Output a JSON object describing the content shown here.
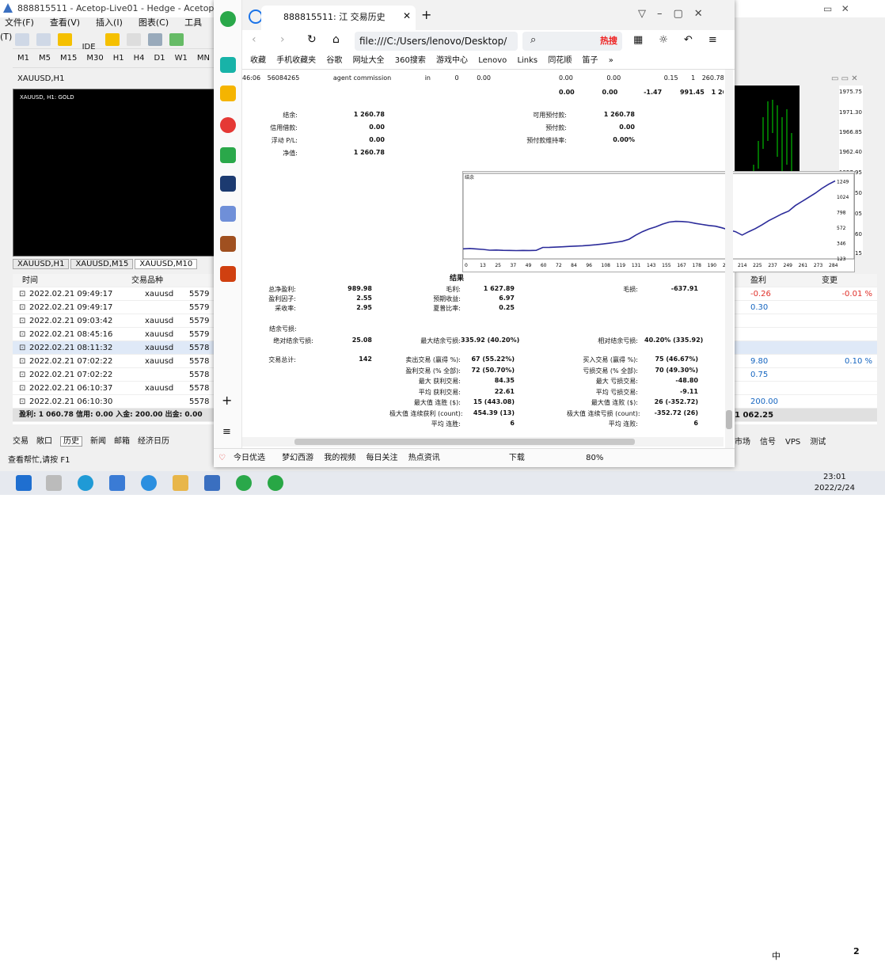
{
  "mt4": {
    "title": "888815511 - Acetop-Live01 - Hedge - Acetop Global",
    "menu": [
      "文件(F)",
      "查看(V)",
      "插入(I)",
      "图表(C)",
      "工具(T)"
    ],
    "toolbar_ide": "IDE",
    "timeframes": [
      "M1",
      "M5",
      "M15",
      "M30",
      "H1",
      "H4",
      "D1",
      "W1",
      "MN"
    ],
    "chart_window_title": "XAUUSD,H1",
    "chart_label": "XAUUSD, H1: GOLD",
    "chart_tabs": [
      "XAUUSD,H1",
      "XAUUSD,M15",
      "XAUUSD,M10"
    ],
    "axis_right": [
      "1975.75",
      "1971.30",
      "1966.85",
      "1962.40",
      "1957.95",
      "1953.50",
      "1949.05",
      "1944.60",
      "1940.15"
    ],
    "table_headers": {
      "time": "时间",
      "symbol": "交易品种",
      "profit": "盈利",
      "change": "变更"
    },
    "trades": [
      {
        "time": "2022.02.21 09:49:17",
        "symbol": "xauusd",
        "id": "5579"
      },
      {
        "time": "2022.02.21 09:49:17",
        "symbol": "",
        "id": "5579"
      },
      {
        "time": "2022.02.21 09:03:42",
        "symbol": "xauusd",
        "id": "5579"
      },
      {
        "time": "2022.02.21 08:45:16",
        "symbol": "xauusd",
        "id": "5579"
      },
      {
        "time": "2022.02.21 08:11:32",
        "symbol": "xauusd",
        "id": "5578"
      },
      {
        "time": "2022.02.21 07:02:22",
        "symbol": "xauusd",
        "id": "5578"
      },
      {
        "time": "2022.02.21 07:02:22",
        "symbol": "",
        "id": "5578"
      },
      {
        "time": "2022.02.21 06:10:37",
        "symbol": "xauusd",
        "id": "5578"
      },
      {
        "time": "2022.02.21 06:10:30",
        "symbol": "",
        "id": "5578"
      }
    ],
    "right_values": [
      {
        "profit": "-0.26",
        "change": "-0.01 %"
      },
      {
        "profit": "0.30",
        "change": ""
      },
      {
        "profit": "",
        "change": ""
      },
      {
        "profit": "",
        "change": ""
      },
      {
        "profit": "",
        "change": ""
      },
      {
        "profit": "9.80",
        "change": "0.10 %"
      },
      {
        "profit": "0.75",
        "change": ""
      },
      {
        "profit": "",
        "change": ""
      },
      {
        "profit": "200.00",
        "change": ""
      }
    ],
    "summary_row": "盈利: 1 060.78  信用: 0.00  入金: 200.00  出金: 0.00",
    "summary_right": "1 062.25",
    "bottom_tabs": [
      "交易",
      "敞口",
      "历史",
      "新闻",
      "邮箱",
      "经济日历"
    ],
    "bottom_right_tabs": [
      "市场",
      "信号",
      "VPS",
      "测试"
    ],
    "status": "查看帮忙,请按 F1"
  },
  "browser": {
    "tab_title": "888815511: 江 交易历史",
    "url": "file:///C:/Users/lenovo/Desktop/",
    "search_hot": "热搜",
    "bookmarks": [
      "收藏",
      "手机收藏夹",
      "谷歌",
      "网址大全",
      "360搜索",
      "游戏中心",
      "Lenovo",
      "Links",
      "同花顺",
      "笛子",
      "»"
    ],
    "status_items": [
      "今日优选",
      "梦幻西游",
      "我的视频",
      "每日关注",
      "热点资讯",
      "下载",
      "80%"
    ]
  },
  "report": {
    "top_row": {
      "time": "46:06",
      "order": "56084265",
      "type": "agent commission",
      "dir": "in",
      "v1": "0",
      "v2": "0.00",
      "c1": "0.00",
      "c2": "0.00",
      "c3": "0.15",
      "c4": "1 260.78"
    },
    "total_row": {
      "a": "0.00",
      "b": "0.00",
      "c": "-1.47",
      "d": "991.45",
      "e": "1 260.78"
    },
    "left_block": [
      {
        "label": "结余:",
        "value": "1 260.78"
      },
      {
        "label": "信用借款:",
        "value": "0.00"
      },
      {
        "label": "浮动 P/L:",
        "value": "0.00"
      },
      {
        "label": "净值:",
        "value": "1 260.78"
      }
    ],
    "right_block": [
      {
        "label": "可用预付款:",
        "value": "1 260.78"
      },
      {
        "label": "预付款:",
        "value": "0.00"
      },
      {
        "label": "预付款维持率:",
        "value": "0.00%"
      }
    ],
    "chart_caption": "结余",
    "results_title": "结果",
    "stats": [
      {
        "l1": "总净盈利:",
        "v1": "989.98",
        "l2": "毛利:",
        "v2": "1 627.89",
        "l3": "毛损:",
        "v3": "-637.91"
      },
      {
        "l1": "盈利因子:",
        "v1": "2.55",
        "l2": "预期收益:",
        "v2": "6.97",
        "l3": "",
        "v3": ""
      },
      {
        "l1": "采收率:",
        "v1": "2.95",
        "l2": "夏普比率:",
        "v2": "0.25",
        "l3": "",
        "v3": ""
      }
    ],
    "drawdown_title": "结余亏损:",
    "drawdown": {
      "l1": "绝对结余亏损:",
      "v1": "25.08",
      "l2": "最大结余亏损:",
      "v2": "335.92 (40.20%)",
      "l3": "相对结余亏损:",
      "v3": "40.20% (335.92)"
    },
    "trades_stats": [
      {
        "l1": "交易总计:",
        "v1": "142",
        "l2": "卖出交易 (赢得 %):",
        "v2": "67 (55.22%)",
        "l3": "买入交易 (赢得 %):",
        "v3": "75 (46.67%)"
      },
      {
        "l1": "",
        "v1": "",
        "l2": "盈利交易 (% 全部):",
        "v2": "72 (50.70%)",
        "l3": "亏损交易 (% 全部):",
        "v3": "70 (49.30%)"
      },
      {
        "l1": "",
        "v1": "",
        "l2": "最大 获利交易:",
        "v2": "84.35",
        "l3": "最大 亏损交易:",
        "v3": "-48.80"
      },
      {
        "l1": "",
        "v1": "",
        "l2": "平均 获利交易:",
        "v2": "22.61",
        "l3": "平均 亏损交易:",
        "v3": "-9.11"
      },
      {
        "l1": "",
        "v1": "",
        "l2": "最大值 连胜 ($):",
        "v2": "15 (443.08)",
        "l3": "最大值 连败 ($):",
        "v3": "26 (-352.72)"
      },
      {
        "l1": "",
        "v1": "",
        "l2": "极大值 连续获利 (count):",
        "v2": "454.39 (13)",
        "l3": "极大值 连续亏损 (count):",
        "v3": "-352.72 (26)"
      },
      {
        "l1": "",
        "v1": "",
        "l2": "平均 连胜:",
        "v2": "6",
        "l3": "平均 连败:",
        "v3": "6"
      }
    ]
  },
  "chart_data": {
    "type": "line",
    "title": "",
    "xlabel": "",
    "ylabel": "",
    "series": [
      {
        "values": [
          270,
          275,
          268,
          262,
          250,
          252,
          248,
          246,
          244,
          246,
          245,
          248,
          290,
          292,
          295,
          300,
          305,
          310,
          315,
          322,
          330,
          340,
          352,
          365,
          380,
          410,
          470,
          520,
          560,
          590,
          630,
          660,
          670,
          668,
          660,
          640,
          625,
          610,
          600,
          575,
          545,
          520,
          470,
          520,
          565,
          620,
          680,
          730,
          780,
          820,
          900,
          960,
          1020,
          1080,
          1150,
          1210,
          1260
        ]
      }
    ],
    "x_ticks": [
      "0",
      "13",
      "25",
      "37",
      "49",
      "60",
      "72",
      "84",
      "96",
      "108",
      "119",
      "131",
      "143",
      "155",
      "167",
      "178",
      "190",
      "202",
      "214",
      "225",
      "237",
      "249",
      "261",
      "273",
      "284"
    ],
    "y_ticks": [
      "123",
      "346",
      "572",
      "798",
      "1024",
      "1249"
    ],
    "ylim": [
      123,
      1300
    ]
  },
  "taskbar": {
    "time": "23:01",
    "date": "2022/2/24",
    "ime": "中",
    "notif": "2"
  },
  "colors": {
    "accent": "#1a73e8",
    "line": "#2b2b9a",
    "candle": "#00e000",
    "negative": "#e0302a",
    "positive": "#1565c0"
  }
}
